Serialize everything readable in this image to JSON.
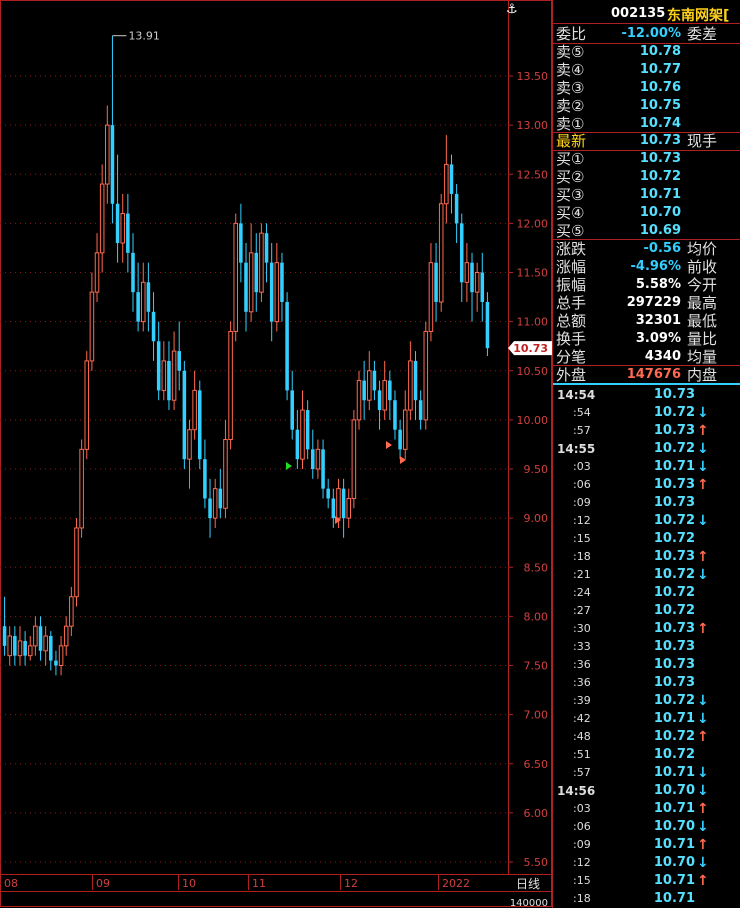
{
  "header": {
    "code": "002135",
    "name": "东南网架[",
    "anchor_icon": "anchor-icon"
  },
  "colors": {
    "up": "#ff6a50",
    "down": "#33d0ff",
    "grid": "#8a1a1a",
    "panel_border": "#b02020",
    "name": "#ffd21a",
    "label": "#e0e0e0"
  },
  "quote": {
    "weibi": {
      "label": "委比",
      "value": "-12.00%",
      "label2": "委差"
    },
    "sell": [
      {
        "label": "卖⑤",
        "value": "10.78"
      },
      {
        "label": "卖④",
        "value": "10.77"
      },
      {
        "label": "卖③",
        "value": "10.76"
      },
      {
        "label": "卖②",
        "value": "10.75"
      },
      {
        "label": "卖①",
        "value": "10.74"
      }
    ],
    "latest": {
      "label": "最新",
      "value": "10.73",
      "label2": "现手"
    },
    "buy": [
      {
        "label": "买①",
        "value": "10.73"
      },
      {
        "label": "买②",
        "value": "10.72"
      },
      {
        "label": "买③",
        "value": "10.71"
      },
      {
        "label": "买④",
        "value": "10.70"
      },
      {
        "label": "买⑤",
        "value": "10.69"
      }
    ],
    "stats": [
      {
        "label": "涨跌",
        "value": "-0.56",
        "label2": "均价",
        "color": "#33d0ff"
      },
      {
        "label": "涨幅",
        "value": "-4.96%",
        "label2": "前收",
        "color": "#33d0ff"
      },
      {
        "label": "振幅",
        "value": "5.58%",
        "label2": "今开",
        "color": "#ffffff"
      },
      {
        "label": "总手",
        "value": "297229",
        "label2": "最高",
        "color": "#ffffff"
      },
      {
        "label": "总额",
        "value": "32301",
        "label2": "最低",
        "color": "#ffffff"
      },
      {
        "label": "换手",
        "value": "3.09%",
        "label2": "量比",
        "color": "#ffffff"
      },
      {
        "label": "分笔",
        "value": "4340",
        "label2": "均量",
        "color": "#ffffff"
      }
    ],
    "outer": {
      "label": "外盘",
      "value": "147676",
      "label2": "内盘"
    }
  },
  "ticks": [
    {
      "time": "14:54",
      "major": true,
      "price": "10.73",
      "dir": ""
    },
    {
      "time": ":54",
      "major": false,
      "price": "10.72",
      "dir": "down"
    },
    {
      "time": ":57",
      "major": false,
      "price": "10.73",
      "dir": "up"
    },
    {
      "time": "14:55",
      "major": true,
      "price": "10.72",
      "dir": "down"
    },
    {
      "time": ":03",
      "major": false,
      "price": "10.71",
      "dir": "down"
    },
    {
      "time": ":06",
      "major": false,
      "price": "10.73",
      "dir": "up"
    },
    {
      "time": ":09",
      "major": false,
      "price": "10.73",
      "dir": ""
    },
    {
      "time": ":12",
      "major": false,
      "price": "10.72",
      "dir": "down"
    },
    {
      "time": ":15",
      "major": false,
      "price": "10.72",
      "dir": ""
    },
    {
      "time": ":18",
      "major": false,
      "price": "10.73",
      "dir": "up"
    },
    {
      "time": ":21",
      "major": false,
      "price": "10.72",
      "dir": "down"
    },
    {
      "time": ":24",
      "major": false,
      "price": "10.72",
      "dir": ""
    },
    {
      "time": ":27",
      "major": false,
      "price": "10.72",
      "dir": ""
    },
    {
      "time": ":30",
      "major": false,
      "price": "10.73",
      "dir": "up"
    },
    {
      "time": ":33",
      "major": false,
      "price": "10.73",
      "dir": ""
    },
    {
      "time": ":36",
      "major": false,
      "price": "10.73",
      "dir": ""
    },
    {
      "time": ":36",
      "major": false,
      "price": "10.73",
      "dir": ""
    },
    {
      "time": ":39",
      "major": false,
      "price": "10.72",
      "dir": "down"
    },
    {
      "time": ":42",
      "major": false,
      "price": "10.71",
      "dir": "down"
    },
    {
      "time": ":48",
      "major": false,
      "price": "10.72",
      "dir": "up"
    },
    {
      "time": ":51",
      "major": false,
      "price": "10.72",
      "dir": ""
    },
    {
      "time": ":57",
      "major": false,
      "price": "10.71",
      "dir": "down"
    },
    {
      "time": "14:56",
      "major": true,
      "price": "10.70",
      "dir": "down"
    },
    {
      "time": ":03",
      "major": false,
      "price": "10.71",
      "dir": "up"
    },
    {
      "time": ":06",
      "major": false,
      "price": "10.70",
      "dir": "down"
    },
    {
      "time": ":09",
      "major": false,
      "price": "10.71",
      "dir": "up"
    },
    {
      "time": ":12",
      "major": false,
      "price": "10.70",
      "dir": "down"
    },
    {
      "time": ":15",
      "major": false,
      "price": "10.71",
      "dir": "up"
    },
    {
      "time": ":18",
      "major": false,
      "price": "10.71",
      "dir": ""
    }
  ],
  "chart": {
    "y_ticks": [
      "13.50",
      "13.00",
      "12.50",
      "12.00",
      "11.50",
      "11.00",
      "10.50",
      "10.00",
      "9.50",
      "9.00",
      "8.50",
      "8.00",
      "7.50",
      "7.00",
      "6.50",
      "6.00",
      "5.50"
    ],
    "x_ticks": [
      "08",
      "09",
      "10",
      "11",
      "12",
      "2022"
    ],
    "period_label": "日线",
    "volume_label": "140000",
    "high_label": "13.91",
    "current_label": "10.73",
    "price_range": [
      5.3,
      14.2
    ]
  }
}
